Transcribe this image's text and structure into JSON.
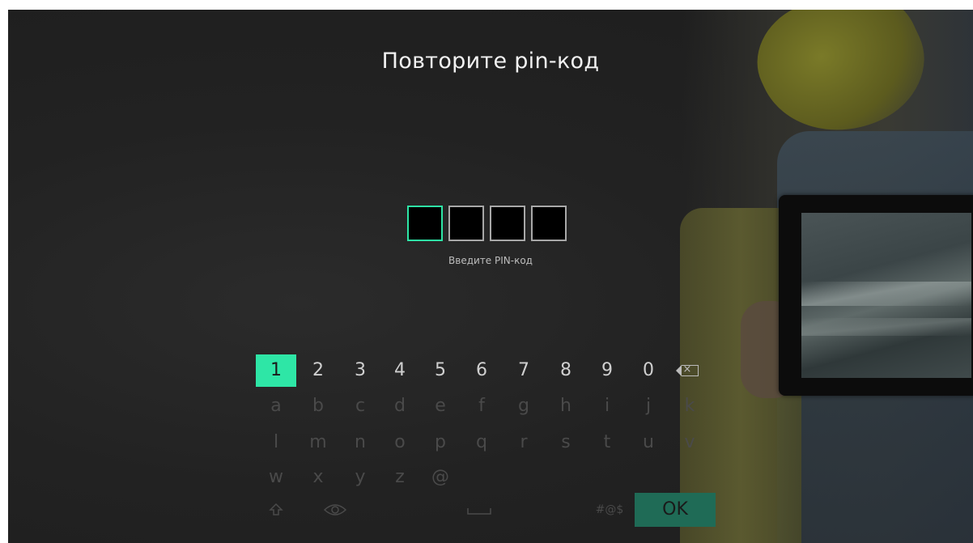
{
  "screen": {
    "title": "Повторите pin-код",
    "pin_hint": "Введите PIN-код",
    "pin_length": 4,
    "active_pin_index": 0
  },
  "keyboard": {
    "digits": [
      "1",
      "2",
      "3",
      "4",
      "5",
      "6",
      "7",
      "8",
      "9",
      "0"
    ],
    "row2": [
      "a",
      "b",
      "c",
      "d",
      "e",
      "f",
      "g",
      "h",
      "i",
      "j",
      "k"
    ],
    "row3": [
      "l",
      "m",
      "n",
      "o",
      "p",
      "q",
      "r",
      "s",
      "t",
      "u",
      "v"
    ],
    "row4": [
      "w",
      "x",
      "y",
      "z",
      "@"
    ],
    "backspace_icon": "backspace-icon",
    "shift_icon": "shift-icon",
    "eye_icon": "eye-icon",
    "space_icon": "space-icon",
    "symbols_label": "#@$",
    "ok_label": "OK",
    "focused_key": "1"
  },
  "colors": {
    "accent": "#2ee6a6",
    "ok_background": "#1f6b56"
  }
}
